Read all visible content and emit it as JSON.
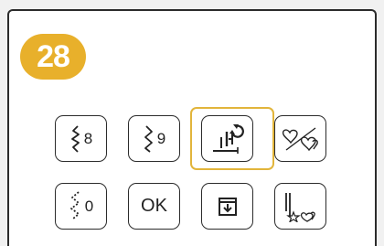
{
  "step_badge": "28",
  "colors": {
    "accent": "#e8b02b",
    "highlight": "#e2b53b",
    "border": "#2b2b2b"
  },
  "keys": [
    {
      "icon": "zigzag-stitch-icon",
      "label": "8"
    },
    {
      "icon": "zigzag-stitch-icon",
      "label": "9"
    },
    {
      "icon": "needle-foot-rotate-icon",
      "label": "",
      "selected": true
    },
    {
      "icon": "heart-stitch-icon",
      "label": ""
    },
    {
      "icon": "dotted-zigzag-stitch-icon",
      "label": "0"
    },
    {
      "icon": "",
      "label": "OK"
    },
    {
      "icon": "memory-download-icon",
      "label": ""
    },
    {
      "icon": "needle-pattern-icon",
      "label": ""
    }
  ]
}
